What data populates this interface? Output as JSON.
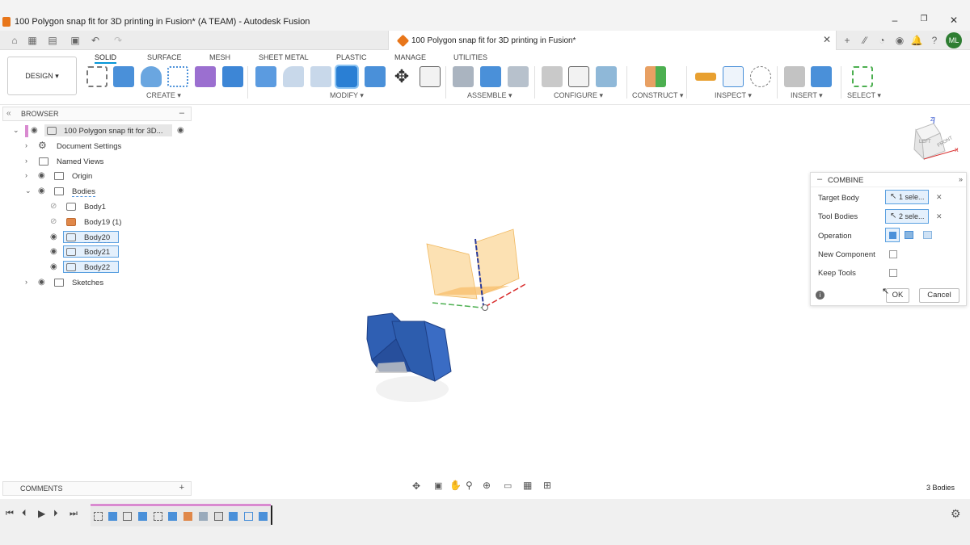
{
  "window": {
    "title": "100 Polygon snap fit for 3D printing in Fusion* (A TEAM) - Autodesk Fusion",
    "min": "–",
    "max": "❐",
    "close": "✕"
  },
  "doc_tab": {
    "label": "100 Polygon snap fit for 3D printing in Fusion*",
    "close": "✕"
  },
  "user": {
    "initials": "ML"
  },
  "workspace": {
    "label": "DESIGN ▾"
  },
  "ribbon": {
    "tabs": [
      "SOLID",
      "SURFACE",
      "MESH",
      "SHEET METAL",
      "PLASTIC",
      "MANAGE",
      "UTILITIES"
    ],
    "groups": [
      "CREATE ▾",
      "MODIFY ▾",
      "ASSEMBLE ▾",
      "CONFIGURE ▾",
      "CONSTRUCT ▾",
      "INSPECT ▾",
      "INSERT ▾",
      "SELECT ▾"
    ]
  },
  "browser": {
    "title": "BROWSER",
    "root": "100 Polygon snap fit for 3D...",
    "items": [
      {
        "label": "Document Settings"
      },
      {
        "label": "Named Views"
      },
      {
        "label": "Origin"
      },
      {
        "label": "Bodies"
      },
      {
        "label": "Body1"
      },
      {
        "label": "Body19 (1)"
      },
      {
        "label": "Body20"
      },
      {
        "label": "Body21"
      },
      {
        "label": "Body22"
      },
      {
        "label": "Sketches"
      }
    ]
  },
  "viewcube": {
    "left": "LEFT",
    "front": "FRONT",
    "z": "Z",
    "x": "X"
  },
  "combine": {
    "title": "COMBINE",
    "target_label": "Target Body",
    "target_value": "1 sele...",
    "tool_label": "Tool Bodies",
    "tool_value": "2 sele...",
    "operation_label": "Operation",
    "new_component_label": "New Component",
    "keep_tools_label": "Keep Tools",
    "ok": "OK",
    "cancel": "Cancel",
    "clear": "✕"
  },
  "comments": {
    "title": "COMMENTS",
    "add": "+"
  },
  "status": {
    "bodies": "3 Bodies"
  },
  "colors": {
    "accent": "#0696d7",
    "body": "#2f5fb3",
    "plane": "#fbd79a"
  }
}
